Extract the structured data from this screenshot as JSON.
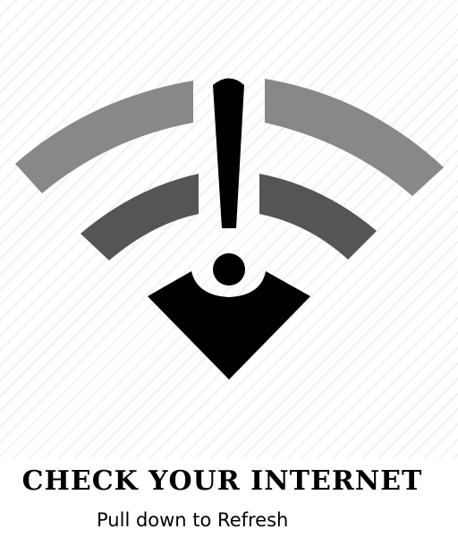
{
  "message": {
    "title": "CHECK YOUR INTERNET",
    "subtitle": "Pull down to Refresh"
  },
  "icon": {
    "name": "wifi-warning-icon",
    "colors": {
      "outer_arc": "#888888",
      "inner_arc": "#555555",
      "base": "#000000",
      "exclamation": "#000000"
    }
  }
}
